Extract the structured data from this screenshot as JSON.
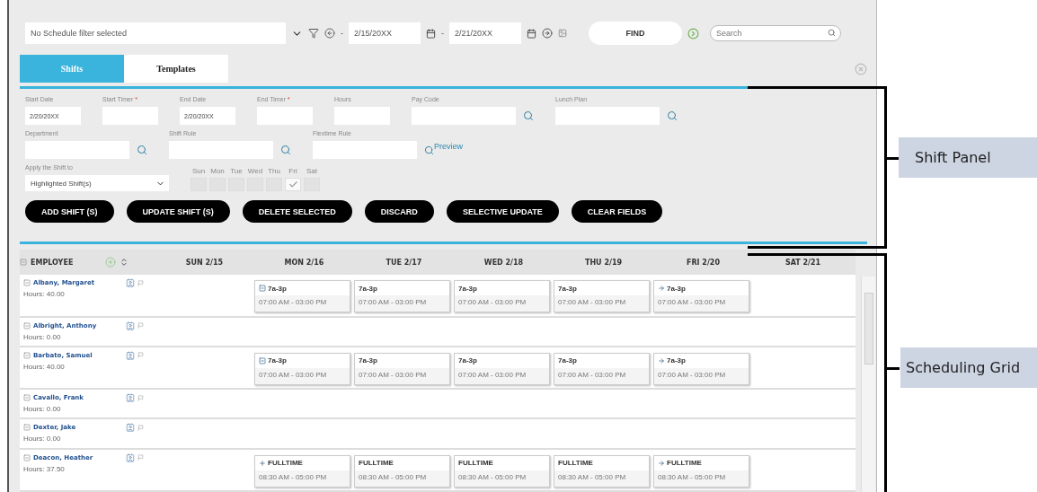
{
  "toolbar": {
    "schedule_filter": "No Schedule filter selected",
    "separator": "-",
    "start_date": "2/15/20XX",
    "end_date": "2/21/20XX",
    "find_button": "FIND",
    "search": {
      "placeholder": "Search"
    }
  },
  "tabs": [
    {
      "label": "Shifts",
      "selected": true
    },
    {
      "label": "Templates",
      "selected": false
    }
  ],
  "shift_panel": {
    "field_rows": [
      [
        {
          "kind": "text",
          "label": "Start Date",
          "value": "2/20/20XX"
        },
        {
          "kind": "text",
          "label": "Start Timer",
          "mark": "*"
        },
        {
          "kind": "text",
          "label": "End Date",
          "value": "2/20/20XX"
        },
        {
          "kind": "text",
          "label": "End Timer",
          "mark": "*"
        },
        {
          "kind": "text",
          "label": "Hours"
        },
        {
          "kind": "lookup",
          "label": "Pay Code"
        },
        {
          "kind": "lookup",
          "label": "Lunch Plan"
        }
      ],
      [
        {
          "kind": "lookup",
          "label": "Department"
        },
        {
          "kind": "lookup",
          "label": "Shift Rule"
        },
        {
          "kind": "preview",
          "label": "Flextime Rule",
          "link": "Preview"
        }
      ]
    ],
    "apply_label": "Apply the Shift to",
    "apply_value": "Highlighted Shift(s)",
    "weekdays": [
      {
        "label": "Sun",
        "checked": false
      },
      {
        "label": "Mon",
        "checked": false
      },
      {
        "label": "Tue",
        "checked": false
      },
      {
        "label": "Wed",
        "checked": false
      },
      {
        "label": "Thu",
        "checked": false
      },
      {
        "label": "Fri",
        "checked": true
      },
      {
        "label": "Sat",
        "checked": false
      }
    ],
    "buttons": [
      "ADD SHIFT (S)",
      "UPDATE SHIFT (S)",
      "DELETE SELECTED",
      "DISCARD",
      "SELECTIVE UPDATE",
      "CLEAR FIELDS"
    ]
  },
  "grid": {
    "employee_header": "EMPLOYEE",
    "days": [
      "SUN 2/15",
      "MON 2/16",
      "TUE 2/17",
      "WED 2/18",
      "THU 2/19",
      "FRI 2/20",
      "SAT 2/21"
    ],
    "rows": [
      {
        "name": "Albany, Margaret",
        "hours": "Hours: 40.00",
        "shifts": [
          {
            "kind": "empty"
          },
          {
            "kind": "start",
            "label": "7a-3p",
            "time": "07:00 AM - 03:00 PM"
          },
          {
            "kind": "plain",
            "label": "7a-3p",
            "time": "07:00 AM - 03:00 PM"
          },
          {
            "kind": "plain",
            "label": "7a-3p",
            "time": "07:00 AM - 03:00 PM"
          },
          {
            "kind": "plain",
            "label": "7a-3p",
            "time": "07:00 AM - 03:00 PM"
          },
          {
            "kind": "end",
            "label": "7a-3p",
            "time": "07:00 AM - 03:00 PM"
          }
        ]
      },
      {
        "name": "Albright, Anthony",
        "hours": "Hours: 0.00",
        "shifts": []
      },
      {
        "name": "Barbato, Samuel",
        "hours": "Hours: 40.00",
        "shifts": [
          {
            "kind": "empty"
          },
          {
            "kind": "start",
            "label": "7a-3p",
            "time": "07:00 AM - 03:00 PM"
          },
          {
            "kind": "plain",
            "label": "7a-3p",
            "time": "07:00 AM - 03:00 PM"
          },
          {
            "kind": "plain",
            "label": "7a-3p",
            "time": "07:00 AM - 03:00 PM"
          },
          {
            "kind": "plain",
            "label": "7a-3p",
            "time": "07:00 AM - 03:00 PM"
          },
          {
            "kind": "end",
            "label": "7a-3p",
            "time": "07:00 AM - 03:00 PM"
          }
        ]
      },
      {
        "name": "Cavallo, Frank",
        "hours": "Hours: 0.00",
        "shifts": []
      },
      {
        "name": "Dexter, Jake",
        "hours": "Hours: 0.00",
        "shifts": []
      },
      {
        "name": "Deacon, Heather",
        "hours": "Hours: 37.50",
        "shifts": [
          {
            "kind": "empty"
          },
          {
            "kind": "add",
            "label": "FULLTIME",
            "time": "08:30 AM - 05:00 PM"
          },
          {
            "kind": "plain",
            "label": "FULLTIME",
            "time": "08:30 AM - 05:00 PM"
          },
          {
            "kind": "plain",
            "label": "FULLTIME",
            "time": "08:30 AM - 05:00 PM"
          },
          {
            "kind": "plain",
            "label": "FULLTIME",
            "time": "08:30 AM - 05:00 PM"
          },
          {
            "kind": "end",
            "label": "FULLTIME",
            "time": "08:30 AM - 05:00 PM"
          }
        ]
      }
    ]
  },
  "callouts": [
    {
      "label": "Shift Panel"
    },
    {
      "label": "Scheduling Grid"
    }
  ]
}
